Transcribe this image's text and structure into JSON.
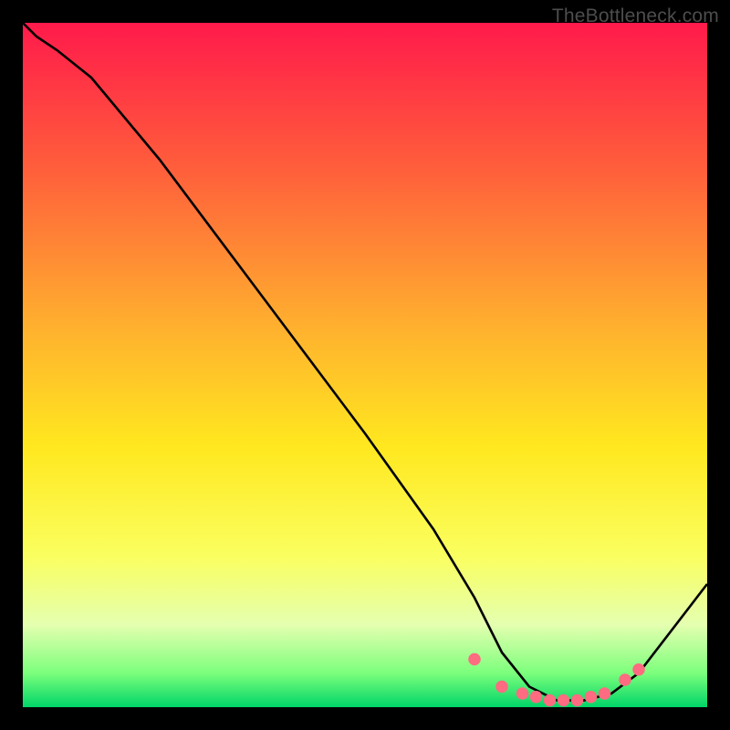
{
  "watermark": "TheBottleneck.com",
  "chart_data": {
    "type": "line",
    "title": "",
    "xlabel": "",
    "ylabel": "",
    "xlim": [
      0,
      100
    ],
    "ylim": [
      0,
      100
    ],
    "background": {
      "gradient_stops": [
        {
          "offset": 0,
          "color": "#ff1a4b"
        },
        {
          "offset": 20,
          "color": "#ff5a3c"
        },
        {
          "offset": 45,
          "color": "#ffb22e"
        },
        {
          "offset": 62,
          "color": "#ffe81f"
        },
        {
          "offset": 78,
          "color": "#faff60"
        },
        {
          "offset": 88,
          "color": "#e4ffb0"
        },
        {
          "offset": 95,
          "color": "#7cff7c"
        },
        {
          "offset": 100,
          "color": "#00d568"
        }
      ]
    },
    "series": [
      {
        "name": "bottleneck-curve",
        "stroke": "#000000",
        "x": [
          0,
          2,
          5,
          10,
          20,
          35,
          50,
          60,
          66,
          70,
          74,
          78,
          82,
          86,
          90,
          100
        ],
        "values": [
          100,
          98,
          96,
          92,
          80,
          60,
          40,
          26,
          16,
          8,
          3,
          1,
          1,
          2,
          5,
          18
        ]
      }
    ],
    "markers": {
      "name": "highlight-points",
      "color": "#ff6b81",
      "points": [
        {
          "x": 66,
          "y": 7
        },
        {
          "x": 70,
          "y": 3
        },
        {
          "x": 73,
          "y": 2
        },
        {
          "x": 75,
          "y": 1.5
        },
        {
          "x": 77,
          "y": 1
        },
        {
          "x": 79,
          "y": 1
        },
        {
          "x": 81,
          "y": 1
        },
        {
          "x": 83,
          "y": 1.5
        },
        {
          "x": 85,
          "y": 2
        },
        {
          "x": 88,
          "y": 4
        },
        {
          "x": 90,
          "y": 5.5
        }
      ]
    }
  }
}
